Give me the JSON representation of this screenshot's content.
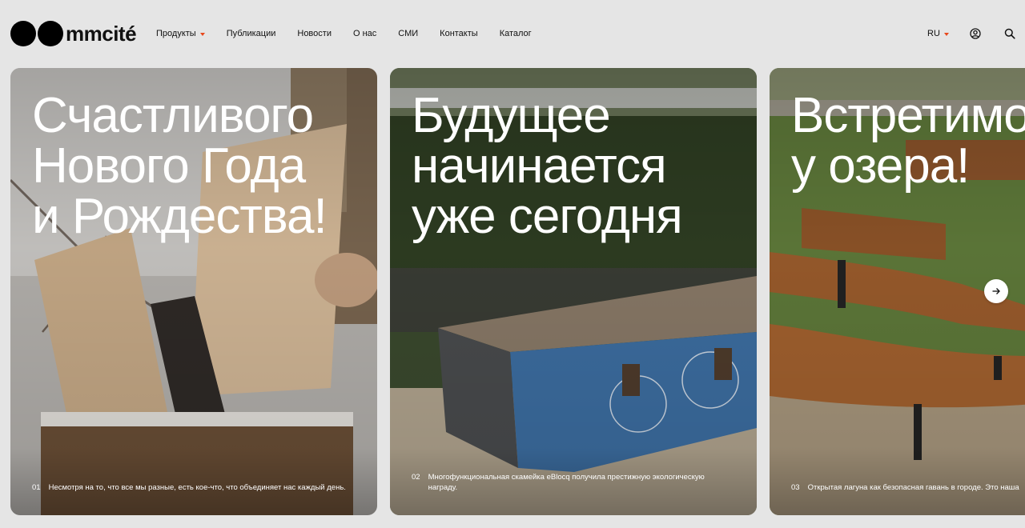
{
  "brand": {
    "name": "mmcité"
  },
  "nav": [
    {
      "label": "Продукты",
      "dropdown": true
    },
    {
      "label": "Публикации"
    },
    {
      "label": "Новости"
    },
    {
      "label": "О нас"
    },
    {
      "label": "СМИ"
    },
    {
      "label": "Контакты"
    },
    {
      "label": "Каталог"
    }
  ],
  "header": {
    "language": "RU",
    "user_icon": "user-icon",
    "search_icon": "search-icon"
  },
  "accent_color": "#e8471b",
  "slides": [
    {
      "title": "Счастливого\nНового Года\nи Рождества!",
      "number": "01",
      "caption": "Несмотря на то, что все мы разные, есть кое-что, что объединяет нас каждый день."
    },
    {
      "title": "Будущее\nначинается\nуже сегодня",
      "number": "02",
      "caption": "Многофункциональная скамейка eBlocq получила престижную экологическую награду."
    },
    {
      "title": "Встретимо\nу озера!",
      "number": "03",
      "caption": "Открытая лагуна как безопасная гавань в городе. Это наша"
    }
  ],
  "carousel": {
    "next_icon": "arrow-right-icon"
  }
}
